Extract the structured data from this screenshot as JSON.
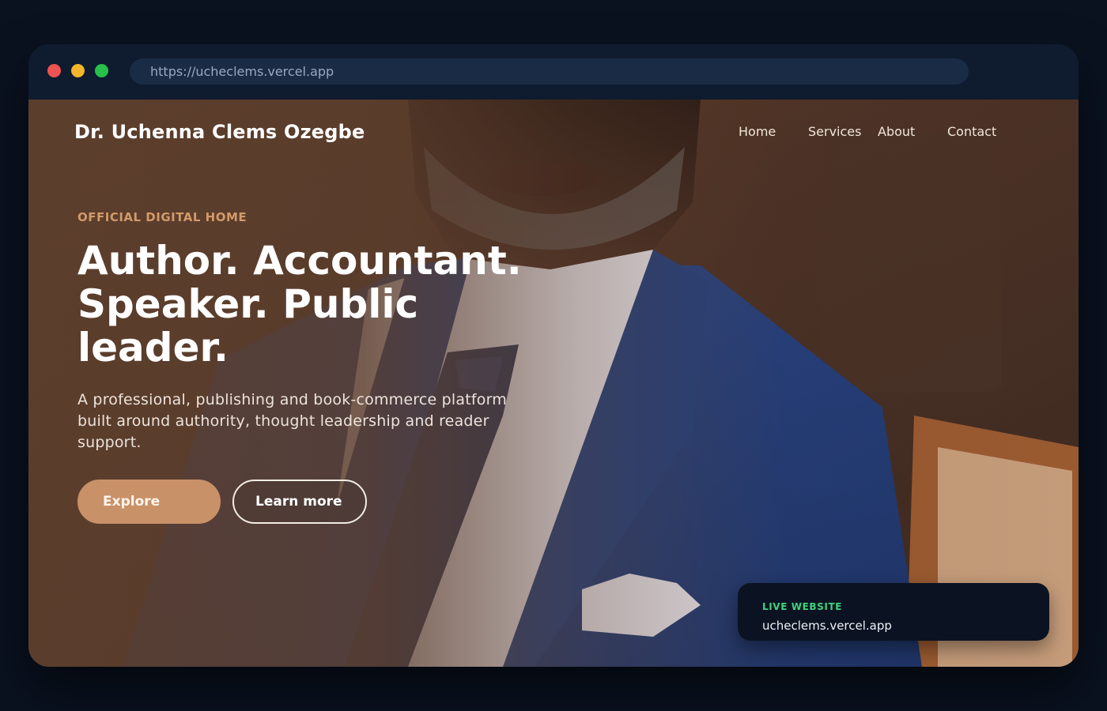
{
  "browser": {
    "url": "https://ucheclems.vercel.app"
  },
  "site": {
    "brand": "Dr. Uchenna Clems Ozegbe",
    "nav": [
      "Home",
      "Services",
      "About",
      "Contact"
    ]
  },
  "hero": {
    "eyebrow": "OFFICIAL DIGITAL HOME",
    "headline_line1": "Author. Accountant.",
    "headline_line2": "Speaker. Public",
    "headline_line3": "leader.",
    "subtitle": "A professional, publishing and book-commerce platform built around authority, thought leadership and reader support.",
    "primary_button": "Explore",
    "secondary_button": "Learn more"
  },
  "live_card": {
    "label": "LIVE WEBSITE",
    "url": "ucheclems.vercel.app"
  },
  "colors": {
    "accent": "#c99168",
    "eyebrow": "#d29a6a",
    "live_green": "#3fd37a",
    "page_bg": "#0a1220"
  }
}
